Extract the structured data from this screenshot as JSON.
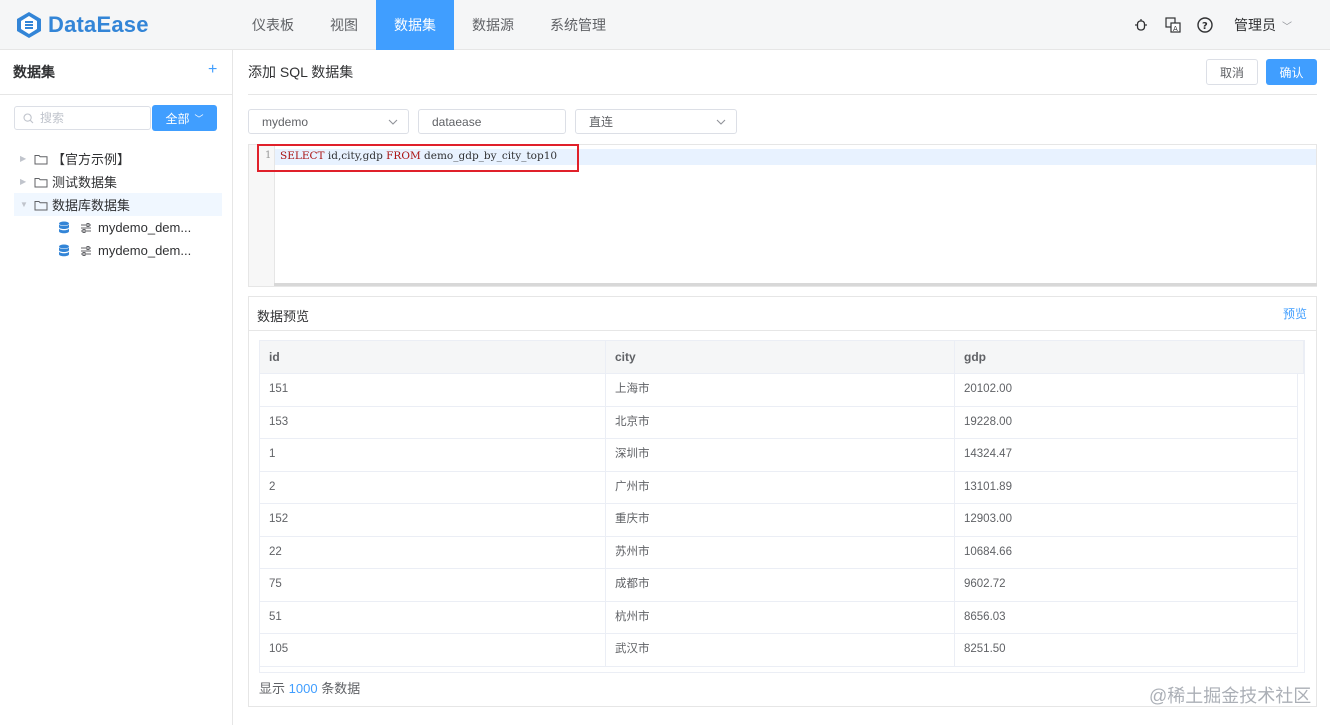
{
  "app": {
    "name": "DataEase"
  },
  "nav": {
    "items": [
      "仪表板",
      "视图",
      "数据集",
      "数据源",
      "系统管理"
    ],
    "active_index": 2
  },
  "header": {
    "user": "管理员"
  },
  "sidebar": {
    "title": "数据集",
    "search_placeholder": "搜索",
    "filter_label": "全部",
    "tree": [
      {
        "label": "【官方示例】",
        "type": "folder"
      },
      {
        "label": "测试数据集",
        "type": "folder"
      },
      {
        "label": "数据库数据集",
        "type": "folder",
        "expanded": true,
        "selected": true
      },
      {
        "label": "mydemo_dem...",
        "type": "sql-dataset"
      },
      {
        "label": "mydemo_dem...",
        "type": "sql-dataset"
      }
    ]
  },
  "main": {
    "title": "添加 SQL 数据集",
    "cancel_label": "取消",
    "confirm_label": "确认",
    "datasource": "mydemo",
    "dataset_name": "dataease",
    "mode": "直连"
  },
  "editor": {
    "line_number": "1",
    "kw_select": "SELECT",
    "columns": " id,city,gdp ",
    "kw_from": "FROM",
    "table": " demo_gdp_by_city_top10"
  },
  "preview": {
    "title": "数据预览",
    "action": "预览",
    "columns": [
      "id",
      "city",
      "gdp"
    ],
    "rows": [
      [
        "151",
        "上海市",
        "20102.00"
      ],
      [
        "153",
        "北京市",
        "19228.00"
      ],
      [
        "1",
        "深圳市",
        "14324.47"
      ],
      [
        "2",
        "广州市",
        "13101.89"
      ],
      [
        "152",
        "重庆市",
        "12903.00"
      ],
      [
        "22",
        "苏州市",
        "10684.66"
      ],
      [
        "75",
        "成都市",
        "9602.72"
      ],
      [
        "51",
        "杭州市",
        "8656.03"
      ],
      [
        "105",
        "武汉市",
        "8251.50"
      ]
    ],
    "footer_prefix": "显示",
    "footer_count": "1000",
    "footer_suffix": "条数据"
  },
  "watermark": "@稀土掘金技术社区",
  "colors": {
    "accent": "#409eff",
    "brand": "#3385d7",
    "highlight": "#e0202a"
  }
}
